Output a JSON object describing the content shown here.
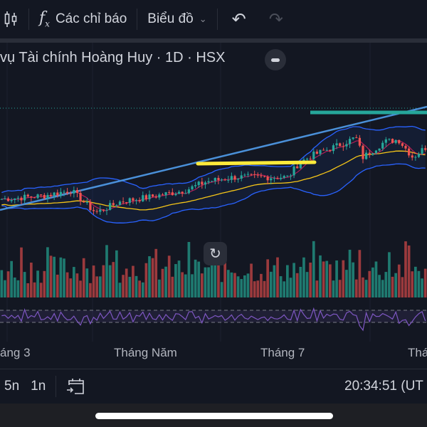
{
  "toolbar": {
    "indicators_label": "Các chỉ báo",
    "chart_label": "Biểu đồ",
    "icons": [
      "candles-icon",
      "function-icon",
      "chevron-down-icon",
      "undo-icon",
      "redo-icon"
    ]
  },
  "legend": {
    "title": "vụ Tài chính Hoàng Huy · 1D · HSX"
  },
  "time_axis": [
    "áng 3",
    "Tháng Năm",
    "Tháng 7",
    "Thá"
  ],
  "bottom": {
    "ranges": [
      "5n",
      "1n"
    ],
    "clock": "20:34:51 (UT"
  },
  "colors": {
    "up": "#26a69a",
    "down": "#ef5350",
    "bb": "#2962ff",
    "ma": "#f5c518",
    "ma_fast": "#e91e63",
    "trend": "#4a90d9",
    "rsi": "#7e57c2"
  },
  "price_path": [
    [
      0,
      42
    ],
    [
      60,
      45
    ],
    [
      100,
      50
    ],
    [
      125,
      35
    ],
    [
      135,
      30
    ],
    [
      170,
      40
    ],
    [
      210,
      44
    ],
    [
      260,
      50
    ],
    [
      290,
      58
    ],
    [
      330,
      62
    ],
    [
      405,
      62
    ],
    [
      420,
      75
    ],
    [
      440,
      82
    ],
    [
      480,
      92
    ],
    [
      500,
      98
    ],
    [
      510,
      80
    ],
    [
      540,
      94
    ],
    [
      560,
      96
    ],
    [
      580,
      80
    ],
    [
      600,
      90
    ]
  ]
}
